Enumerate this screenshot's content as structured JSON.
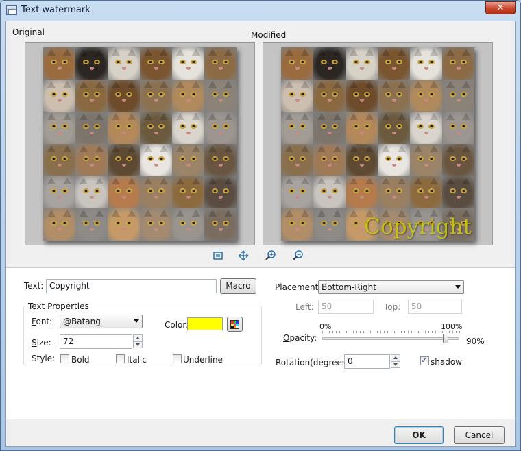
{
  "window": {
    "title": "Text watermark",
    "close_glyph": "✕"
  },
  "preview": {
    "original_label": "Original",
    "modified_label": "Modified",
    "watermark_text": "Copyright",
    "tile_colors": [
      "#9a6b3f",
      "#2b2622",
      "#d7d2c8",
      "#7a5530",
      "#e6e3dd",
      "#8c6a45",
      "#cdbfb0",
      "#8a6840",
      "#6e4b2a",
      "#8c7150",
      "#b08a5c",
      "#8b8378",
      "#a39c94",
      "#7d756c",
      "#b3885a",
      "#6b5a3e",
      "#d9d4cc",
      "#9c9590",
      "#8a6f4c",
      "#a07a56",
      "#5e4a32",
      "#e9e6e1",
      "#9b8468",
      "#6a5640",
      "#a8a39e",
      "#c9c4be",
      "#b57b4c",
      "#9a7f60",
      "#8d6a3e",
      "#5a4c40",
      "#b28e68",
      "#8e8a86",
      "#c59a68",
      "#a38a70",
      "#9a948e",
      "#7a6d60"
    ]
  },
  "zoom_toolbar": [
    {
      "name": "fit-image-icon"
    },
    {
      "name": "actual-size-icon"
    },
    {
      "name": "zoom-in-icon"
    },
    {
      "name": "zoom-out-icon"
    }
  ],
  "form": {
    "text_label": "Text:",
    "text_value": "Copyright",
    "macro_label": "Macro",
    "text_properties_title": "Text Properties",
    "font_label_key": "F",
    "font_label_rest": "ont:",
    "font_value": "@Batang",
    "color_label": "Color:",
    "color_value": "#ffff00",
    "size_label_key": "S",
    "size_label_rest": "ize:",
    "size_value": "72",
    "style_label": "Style:",
    "bold_label": "Bold",
    "italic_label": "Italic",
    "underline_label": "Underline",
    "bold_checked": false,
    "italic_checked": false,
    "underline_checked": false,
    "placement_label": "Placement:",
    "placement_value": "Bottom-Right",
    "left_label": "Left:",
    "left_value": "50",
    "top_label": "Top:",
    "top_value": "50",
    "opacity_min": "0%",
    "opacity_max": "100%",
    "opacity_label_key": "O",
    "opacity_label_rest": "pacity:",
    "opacity_value_text": "90%",
    "opacity_value": 0.9,
    "rotation_label": "Rotation(degrees):",
    "rotation_value": "0",
    "shadow_label": "shadow",
    "shadow_checked": true
  },
  "buttons": {
    "ok_label": "OK",
    "cancel_label": "Cancel"
  }
}
